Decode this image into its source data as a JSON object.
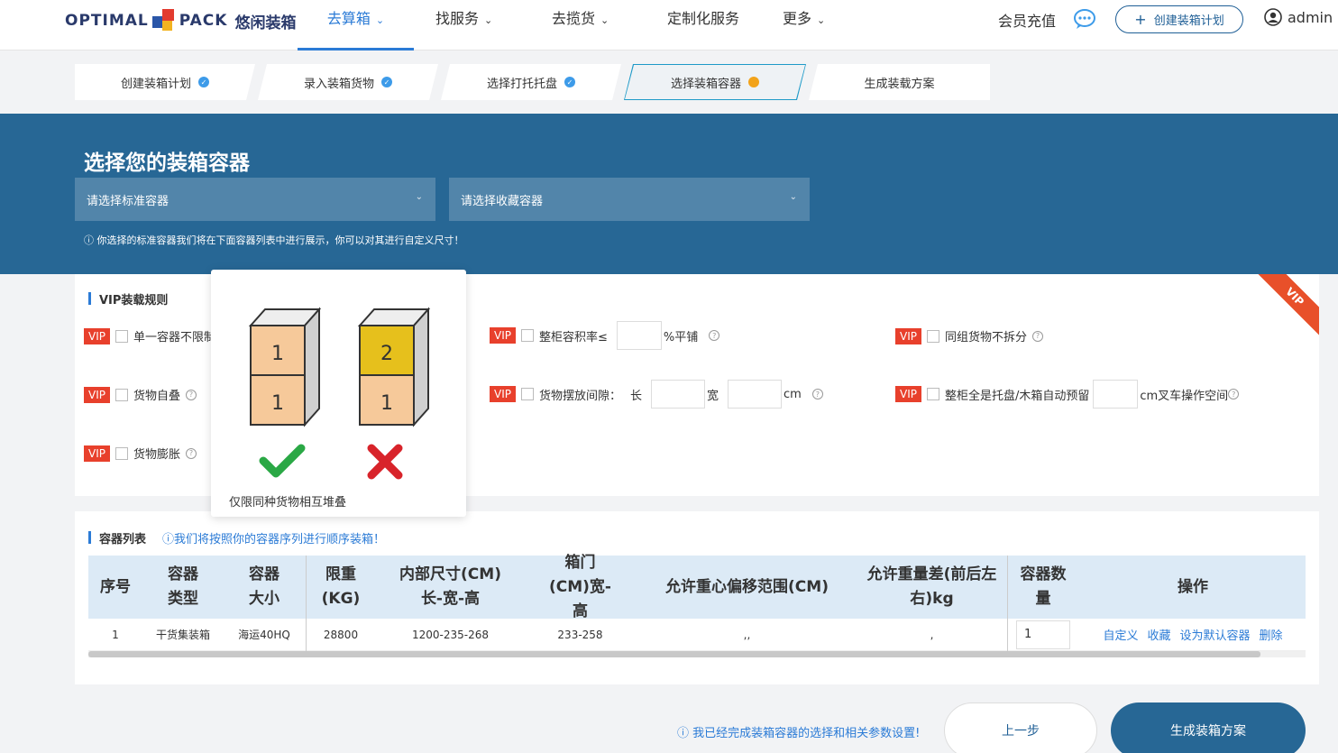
{
  "header": {
    "logo_text_left": "OPTIMAL",
    "logo_text_right": "PACK",
    "logo_cn": "悠闲装箱",
    "nav": [
      {
        "label": "去算箱",
        "has_dropdown": true,
        "active": true
      },
      {
        "label": "找服务",
        "has_dropdown": true,
        "active": false
      },
      {
        "label": "去揽货",
        "has_dropdown": true,
        "active": false
      },
      {
        "label": "定制化服务",
        "has_dropdown": false,
        "active": false
      },
      {
        "label": "更多",
        "has_dropdown": true,
        "active": false
      }
    ],
    "member_label": "会员充值",
    "create_plan_label": "创建装箱计划",
    "user_name": "admin",
    "accent": "#2b7bd6"
  },
  "steps": [
    {
      "label": "创建装箱计划",
      "state": "done"
    },
    {
      "label": "录入装箱货物",
      "state": "done"
    },
    {
      "label": "选择打托托盘",
      "state": "done"
    },
    {
      "label": "选择装箱容器",
      "state": "current"
    },
    {
      "label": "生成装载方案",
      "state": "pending"
    }
  ],
  "banner": {
    "title": "选择您的装箱容器",
    "standard_select_placeholder": "请选择标准容器",
    "favorite_select_placeholder": "请选择收藏容器",
    "hint": "ⓘ 你选择的标准容器我们将在下面容器列表中进行展示，你可以对其进行自定义尺寸！",
    "bg_color": "#276795"
  },
  "vip": {
    "title": "VIP装载规则",
    "ribbon": "VIP",
    "tag": "VIP",
    "rules": {
      "single_container": "单一容器不限制",
      "self_stack": "货物自叠",
      "expand": "货物膨胀",
      "volume_rate_prefix": "整柜容积率≤",
      "volume_rate_suffix": "%平铺",
      "gap_prefix": "货物摆放间隙：",
      "gap_len": "长",
      "gap_width": "宽",
      "gap_unit": "cm",
      "group_nosplit": "同组货物不拆分",
      "pallet_reserve_prefix": "整柜全是托盘/木箱自动预留",
      "pallet_reserve_suffix": "cm叉车操作空间"
    }
  },
  "popover": {
    "caption": "仅限同种货物相互堆叠",
    "left_stack": [
      "1",
      "1"
    ],
    "right_stack": [
      "2",
      "1"
    ]
  },
  "container_list": {
    "title": "容器列表",
    "hint": "ⓘ我们将按照你的容器序列进行顺序装箱！",
    "columns": [
      "序号",
      "容器类型",
      "容器大小",
      "限重(KG)",
      "内部尺寸(CM)长-宽-高",
      "箱门(CM)宽-高",
      "允许重心偏移范围(CM)",
      "允许重量差(前后左右)kg",
      "容器数量",
      "操作"
    ],
    "rows": [
      {
        "index": "1",
        "type": "干货集装箱",
        "size": "海运40HQ",
        "max_weight": "28800",
        "inner_dims": "1200-235-268",
        "door": "233-258",
        "cog_offset": ",,",
        "weight_diff": ",",
        "qty": "1"
      }
    ],
    "actions": [
      "自定义",
      "收藏",
      "设为默认容器",
      "删除"
    ]
  },
  "footer": {
    "hint": "ⓘ 我已经完成装箱容器的选择和相关参数设置!",
    "prev_label": "上一步",
    "generate_label": "生成装箱方案"
  }
}
